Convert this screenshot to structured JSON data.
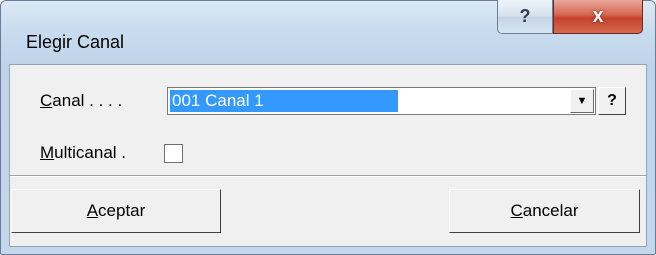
{
  "window": {
    "title": "Elegir Canal"
  },
  "titlebar": {
    "help_glyph": "?",
    "close_glyph": "x"
  },
  "form": {
    "canal_label_mnemonic": "C",
    "canal_label_rest": "anal . . . .",
    "canal_value": "001 Canal 1",
    "help_button": "?",
    "multicanal_label_mnemonic": "M",
    "multicanal_label_rest": "ulticanal .",
    "multicanal_checked": false
  },
  "buttons": {
    "ok_mnemonic": "A",
    "ok_rest": "ceptar",
    "cancel_mnemonic": "C",
    "cancel_rest": "ancelar"
  },
  "colors": {
    "selection": "#3399ff",
    "close": "#c7402a"
  },
  "icons": {
    "dropdown": "down-triangle"
  }
}
